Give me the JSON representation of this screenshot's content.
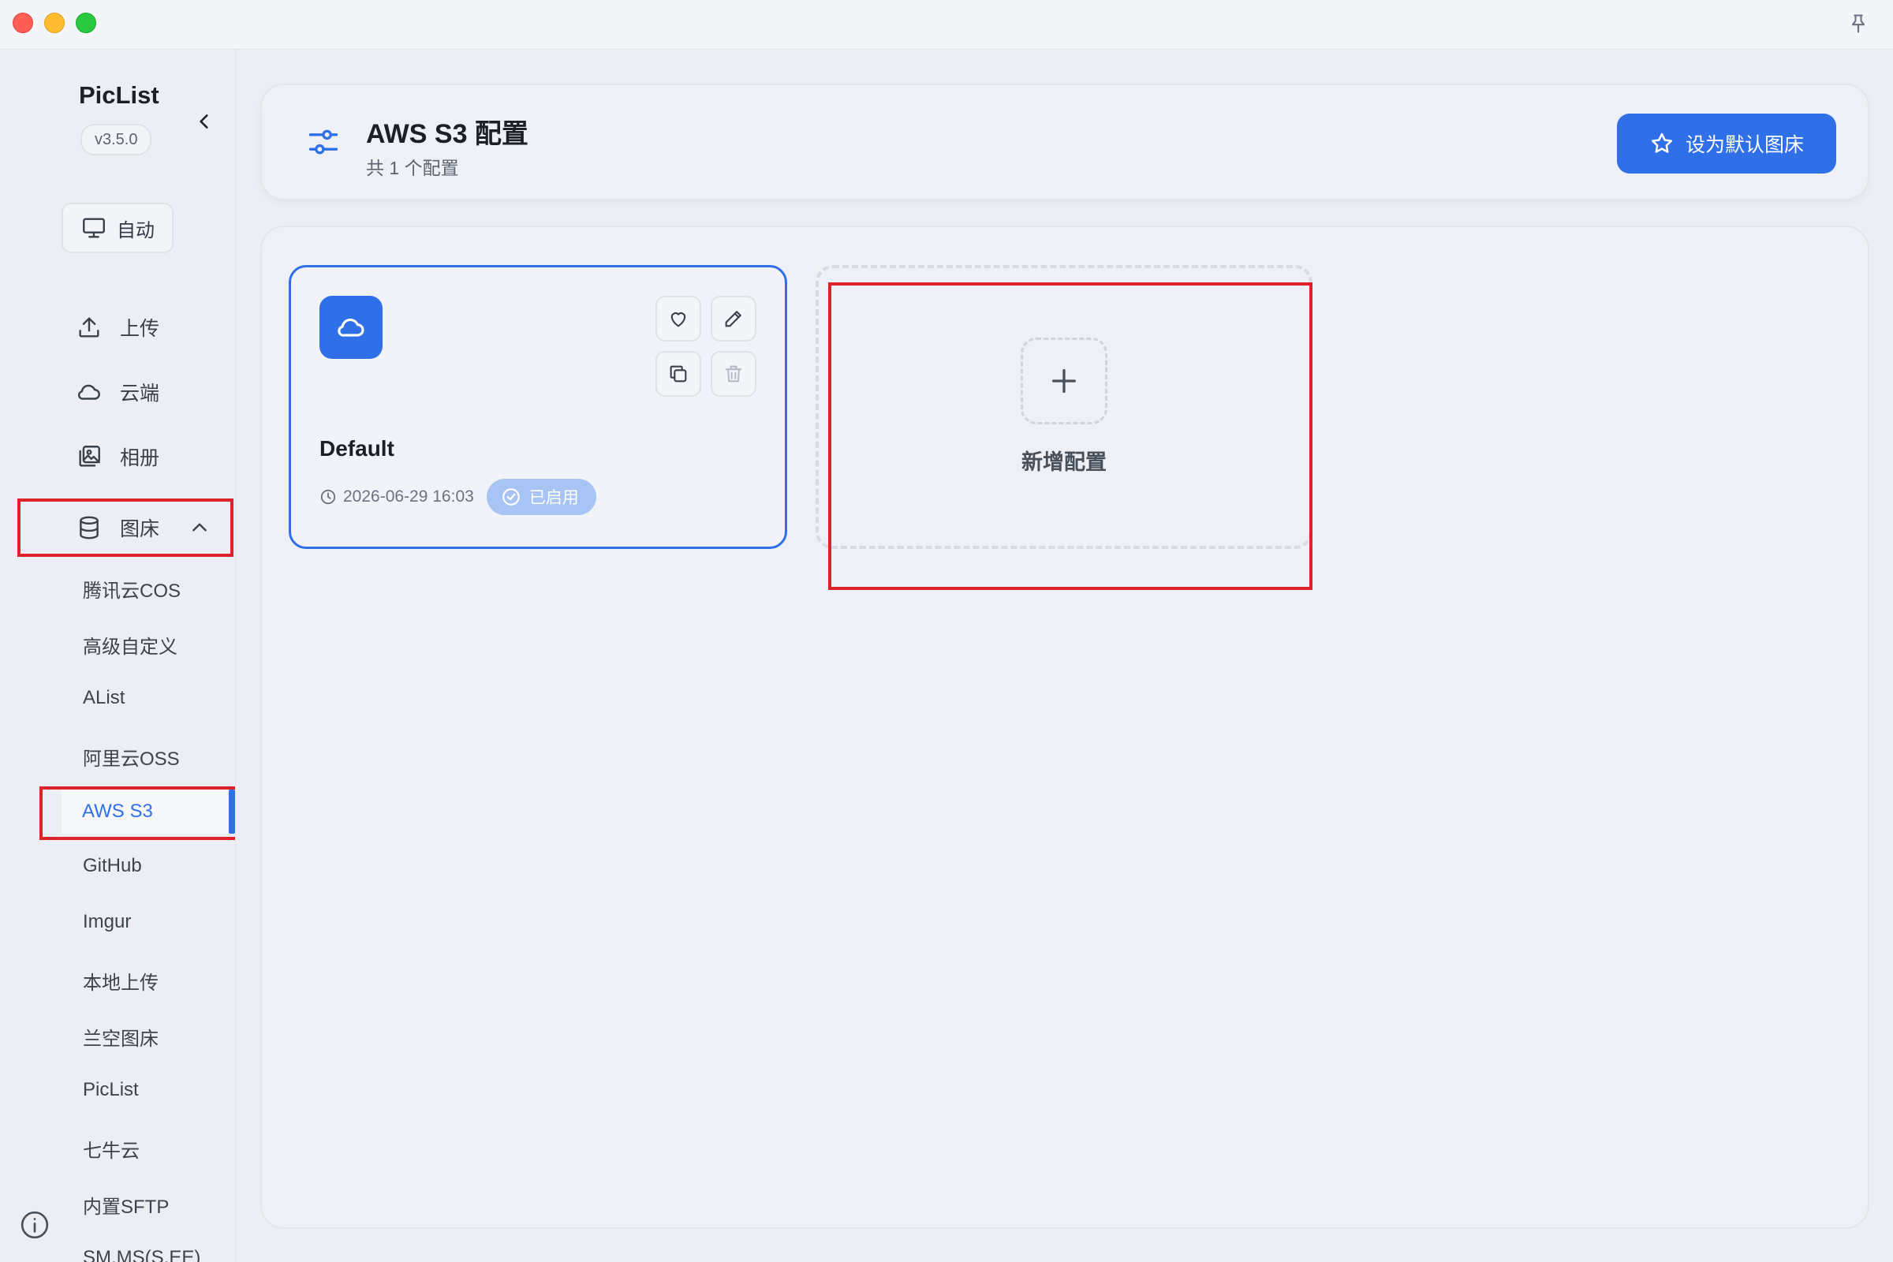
{
  "app": {
    "name": "PicList",
    "version": "v3.5.0",
    "mode_label": "自动"
  },
  "sidebar": {
    "nav": [
      {
        "label": "上传",
        "icon": "upload-icon"
      },
      {
        "label": "云端",
        "icon": "cloud-icon"
      },
      {
        "label": "相册",
        "icon": "gallery-icon"
      }
    ],
    "image_bed": {
      "label": "图床",
      "icon": "database-icon",
      "expanded": true
    },
    "image_bed_items": [
      "腾讯云COS",
      "高级自定义",
      "AList",
      "阿里云OSS",
      "AWS S3",
      "GitHub",
      "Imgur",
      "本地上传",
      "兰空图床",
      "PicList",
      "七牛云",
      "内置SFTP",
      "SM.MS(S.EE)"
    ],
    "active_item": "AWS S3"
  },
  "header": {
    "title": "AWS S3 配置",
    "subtitle": "共 1 个配置",
    "set_default_label": "设为默认图床"
  },
  "configs": [
    {
      "name": "Default",
      "timestamp": "2026-06-29 16:03",
      "status": "已启用"
    }
  ],
  "add_config_label": "新增配置",
  "colors": {
    "accent": "#2f6fe8",
    "highlight": "#e0232a",
    "status_badge": "#a8c4f5"
  }
}
